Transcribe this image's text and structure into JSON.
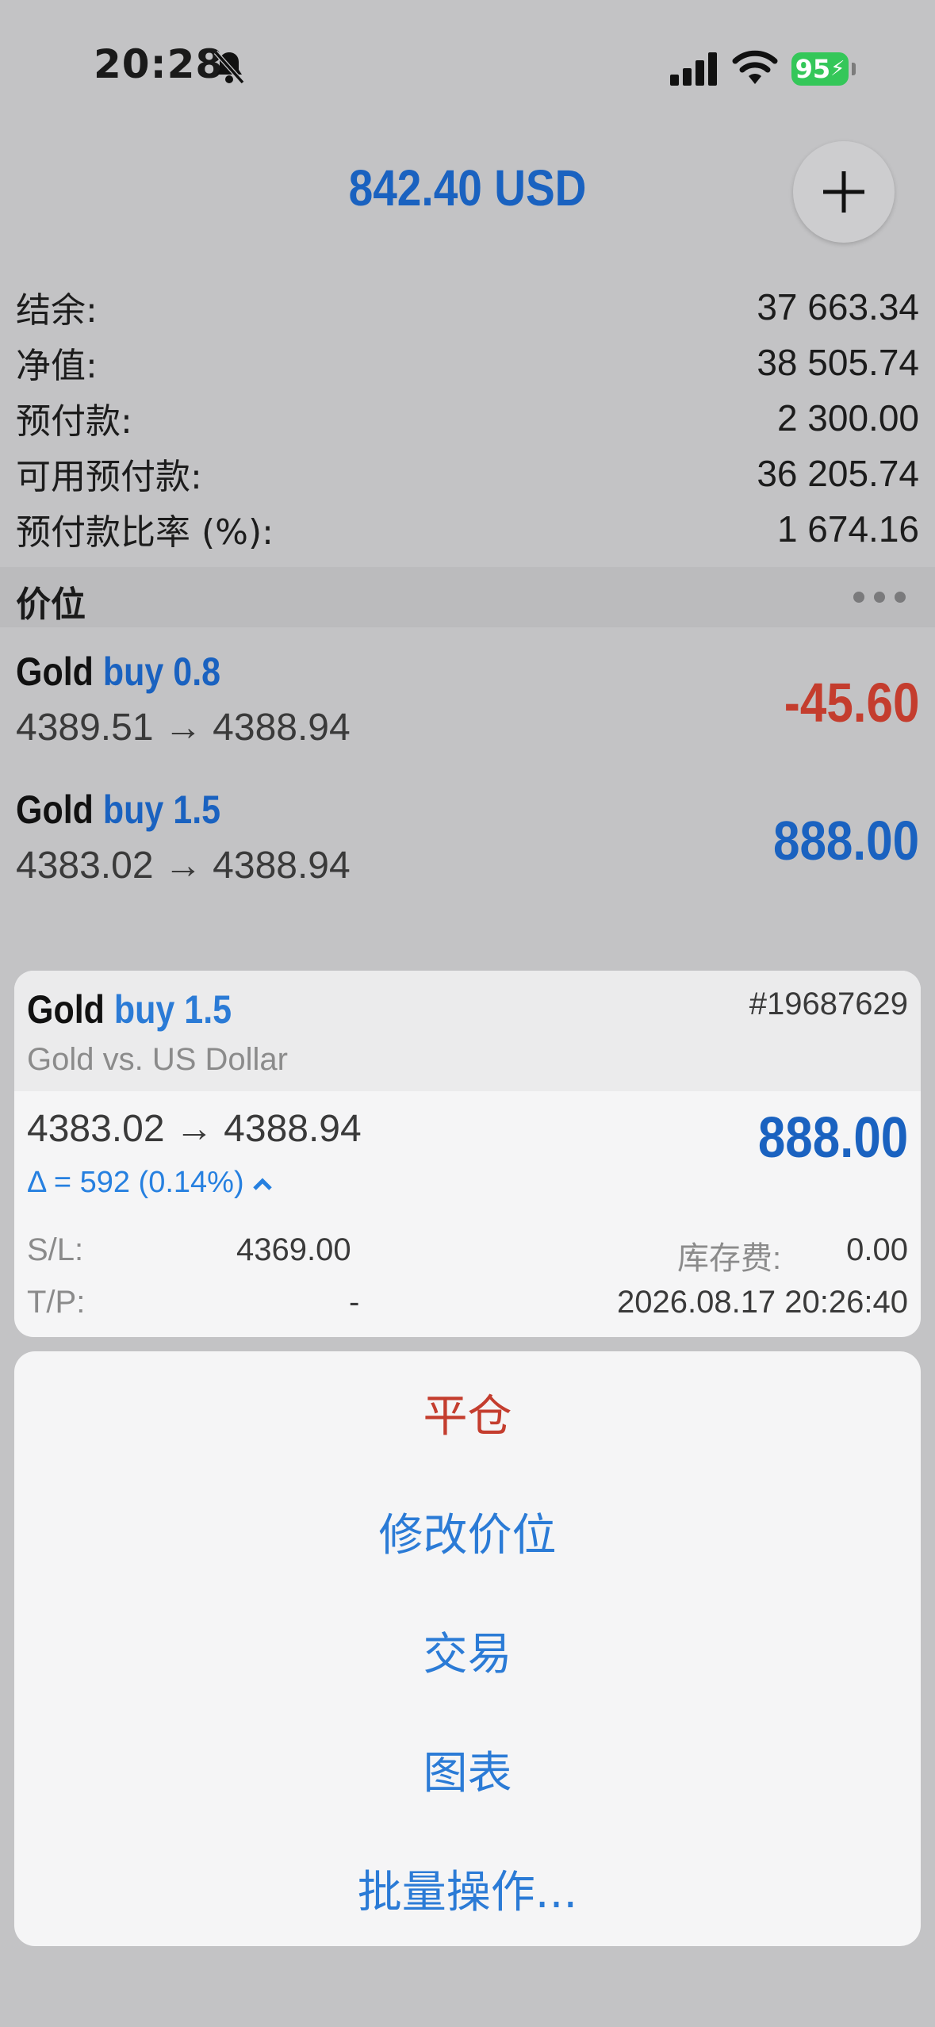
{
  "status_bar": {
    "time": "20:28",
    "battery": "95"
  },
  "header": {
    "title": "842.40 USD"
  },
  "account": {
    "rows": [
      {
        "label": "结余:",
        "value": "37 663.34"
      },
      {
        "label": "净值:",
        "value": "38 505.74"
      },
      {
        "label": "预付款:",
        "value": "2 300.00"
      },
      {
        "label": "可用预付款:",
        "value": "36 205.74"
      },
      {
        "label": "预付款比率 (%):",
        "value": "1 674.16"
      }
    ]
  },
  "positions": {
    "title": "价位",
    "items": [
      {
        "symbol": "Gold",
        "side": "buy 0.8",
        "prices": "4389.51 → 4388.94",
        "profit": "-45.60",
        "profit_color": "#c43d2e"
      },
      {
        "symbol": "Gold",
        "side": "buy 1.5",
        "prices": "4383.02 → 4388.94",
        "profit": "888.00",
        "profit_color": "#1a62c0"
      }
    ]
  },
  "detail": {
    "symbol": "Gold",
    "side": "buy 1.5",
    "ticket": "#19687629",
    "description": "Gold vs. US Dollar",
    "prices": "4383.02 → 4388.94",
    "profit": "888.00",
    "delta": "Δ = 592 (0.14%)",
    "sl_label": "S/L:",
    "sl_value": "4369.00",
    "tp_label": "T/P:",
    "tp_value": "-",
    "swap_label": "库存费:",
    "swap_value": "0.00",
    "open_time": "2026.08.17 20:26:40"
  },
  "actions": {
    "close": "平仓",
    "modify": "修改价位",
    "trade": "交易",
    "chart": "图表",
    "bulk": "批量操作..."
  },
  "colors": {
    "accent": "#1a62c0",
    "loss": "#c43d2e",
    "action_blue": "#2b7bd6"
  }
}
